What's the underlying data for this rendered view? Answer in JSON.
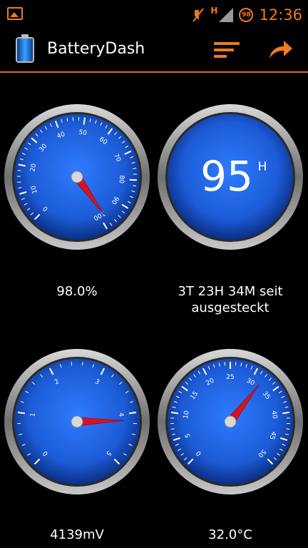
{
  "status_bar": {
    "time": "12:36",
    "battery_level": "98",
    "network_type": "H",
    "icons": [
      "picture-icon",
      "muted-icon",
      "signal-icon",
      "battery-icon"
    ]
  },
  "action_bar": {
    "title": "BatteryDash",
    "icons": [
      "battery-app-icon",
      "menu-icon",
      "share-icon"
    ]
  },
  "gauges": {
    "level": {
      "ticks": [
        "0",
        "10",
        "20",
        "30",
        "40",
        "50",
        "60",
        "70",
        "80",
        "90",
        "100"
      ],
      "value": 98.0,
      "readout": "98.0%"
    },
    "uptime": {
      "center_value": "95",
      "center_unit": "H",
      "readout_line1": "3T 23H 34M seit",
      "readout_line2": "ausgesteckt"
    },
    "voltage": {
      "ticks": [
        "0",
        "1",
        "2",
        "3",
        "4",
        "5"
      ],
      "value": 4.139,
      "readout": "4139mV"
    },
    "temperature": {
      "ticks": [
        "0",
        "5",
        "10",
        "15",
        "20",
        "25",
        "30",
        "35",
        "40",
        "45",
        "50"
      ],
      "value": 32.0,
      "readout": "32.0°C"
    }
  },
  "colors": {
    "accent": "#f07a1d",
    "dial_blue": "#1c5bd6",
    "needle": "#d9121e"
  }
}
